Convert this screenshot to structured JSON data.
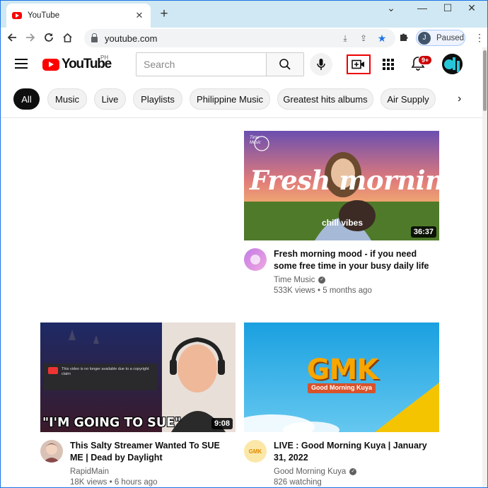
{
  "browser": {
    "tab_title": "YouTube",
    "url": "youtube.com",
    "profile_initial": "J",
    "profile_status": "Paused"
  },
  "header": {
    "logo_text": "YouTube",
    "region": "PH",
    "search_placeholder": "Search",
    "notification_count": "9+"
  },
  "chips": [
    "All",
    "Music",
    "Live",
    "Playlists",
    "Philippine Music",
    "Greatest hits albums",
    "Air Supply"
  ],
  "videos": [
    {
      "title": "Fresh morning mood - if you need some free time in your busy daily life",
      "channel": "Time Music",
      "stats": "533K views • 5 months ago",
      "duration": "36:37",
      "thumb_text": "Fresh morning",
      "thumb_sub": "chill vibes",
      "thumb_logo": "Time Music",
      "verified": true
    },
    {
      "title": "This Salty Streamer Wanted To SUE ME | Dead by Daylight",
      "channel": "RapidMain",
      "stats": "18K views • 6 hours ago",
      "duration": "9:08",
      "thumb_text": "\"I'M GOING TO SUE\"",
      "thumb_notice": "This video is no longer available due to a copyright claim",
      "verified": false
    },
    {
      "title": "LIVE : Good Morning Kuya | January 31, 2022",
      "channel": "Good Morning Kuya",
      "stats": "826 watching",
      "thumb_text": "GMK",
      "thumb_sub": "Good Morning Kuya",
      "channel_avatar_text": "GMK",
      "verified": true
    }
  ]
}
